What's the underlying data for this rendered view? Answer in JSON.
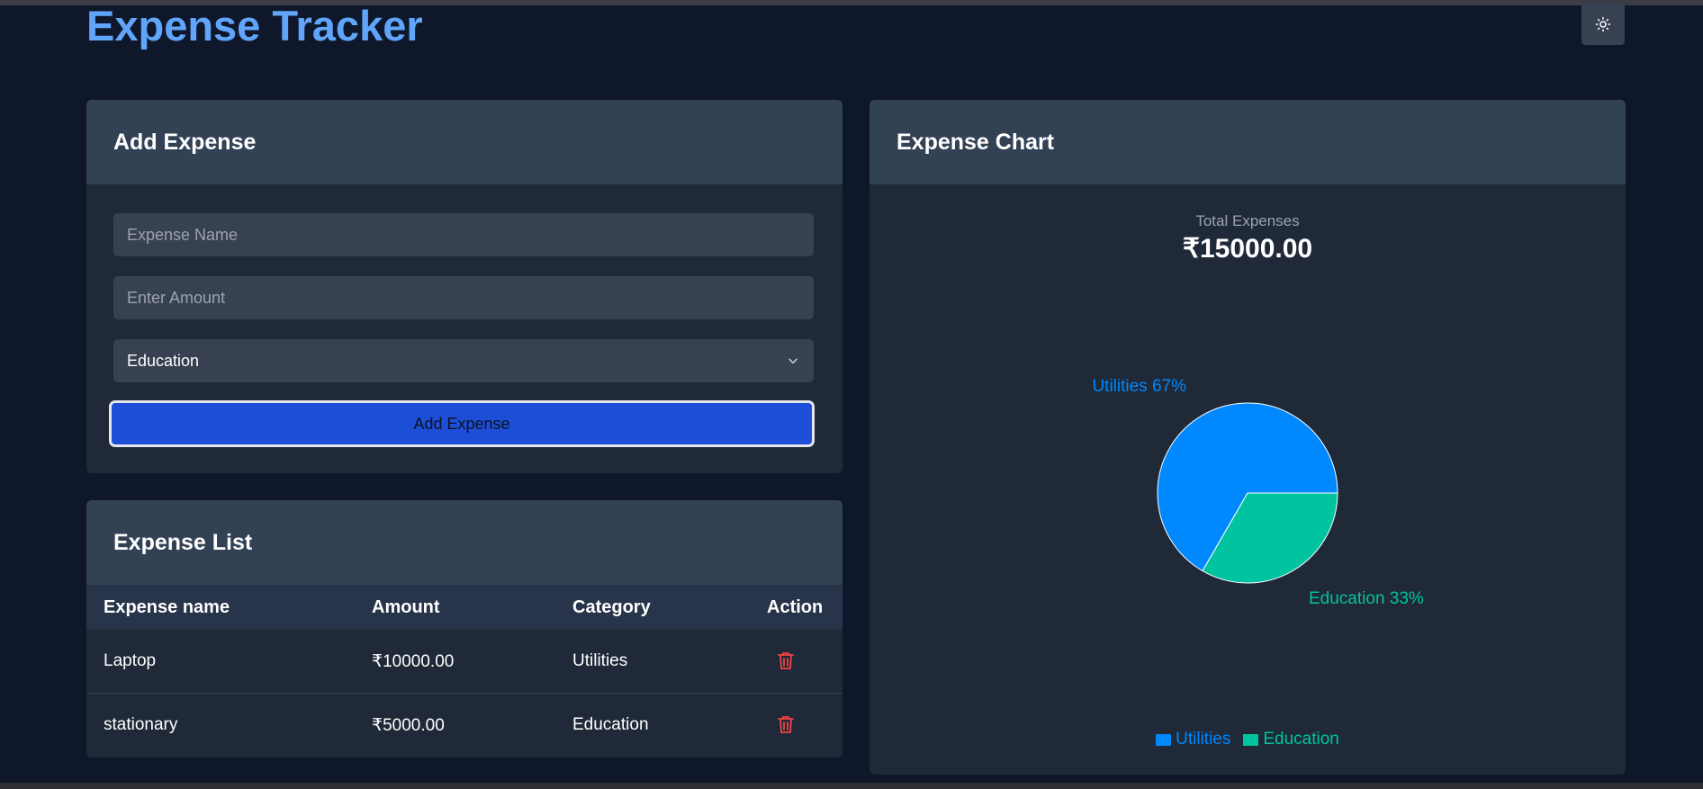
{
  "app": {
    "title": "Expense Tracker",
    "theme_toggle_icon": "sun-icon"
  },
  "add_expense": {
    "title": "Add Expense",
    "name_placeholder": "Expense Name",
    "amount_placeholder": "Enter Amount",
    "category_selected": "Education",
    "submit_label": "Add Expense"
  },
  "expense_list": {
    "title": "Expense List",
    "columns": [
      "Expense name",
      "Amount",
      "Category",
      "Action"
    ],
    "rows": [
      {
        "name": "Laptop",
        "amount": "₹10000.00",
        "category": "Utilities",
        "action_icon": "trash-icon"
      },
      {
        "name": "stationary",
        "amount": "₹5000.00",
        "category": "Education",
        "action_icon": "trash-icon"
      }
    ]
  },
  "expense_chart": {
    "title": "Expense Chart",
    "total_label": "Total Expenses",
    "total_value": "₹15000.00"
  },
  "colors": {
    "utilities": "#0088fe",
    "education": "#00c49f",
    "accent": "#60a5fa",
    "delete": "#ef4444"
  },
  "chart_data": {
    "type": "pie",
    "categories": [
      "Utilities",
      "Education"
    ],
    "values": [
      10000,
      5000
    ],
    "labels": [
      "Utilities 67%",
      "Education 33%"
    ],
    "legend": [
      "Utilities",
      "Education"
    ],
    "legend_position": "bottom"
  }
}
